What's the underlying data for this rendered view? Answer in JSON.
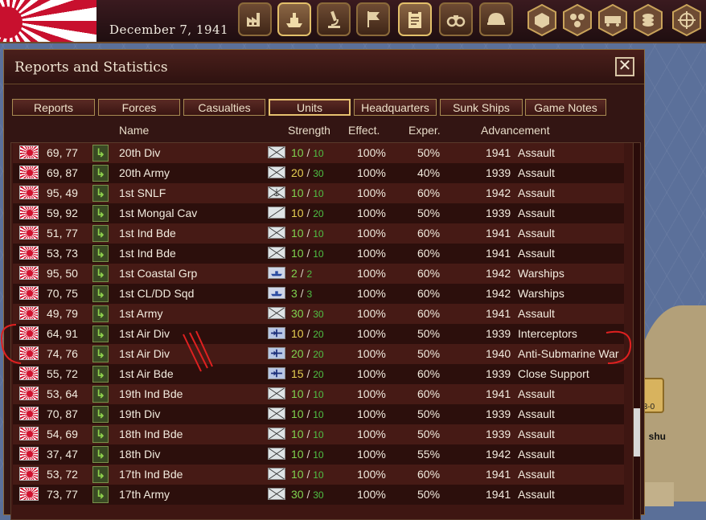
{
  "top_bar": {
    "date": "December 7, 1941",
    "buttons": [
      {
        "name": "production-button",
        "icon": "factory-icon"
      },
      {
        "name": "naval-button",
        "icon": "ship-icon"
      },
      {
        "name": "research-button",
        "icon": "microscope-icon"
      },
      {
        "name": "objectives-button",
        "icon": "flag-icon"
      },
      {
        "name": "reports-button",
        "icon": "clipboard-icon",
        "active": true
      },
      {
        "name": "intelligence-button",
        "icon": "binoculars-icon"
      },
      {
        "name": "army-button",
        "icon": "helmet-icon"
      }
    ],
    "hex_buttons": [
      "hex-tile-icon",
      "hex-grid-icon",
      "train-icon",
      "coins-icon",
      "crosshair-icon"
    ]
  },
  "window": {
    "title": "Reports and Statistics",
    "close_label": "✕",
    "tabs": [
      {
        "label": "Reports"
      },
      {
        "label": "Forces"
      },
      {
        "label": "Casualties"
      },
      {
        "label": "Units",
        "active": true
      },
      {
        "label": "Headquarters"
      },
      {
        "label": "Sunk Ships"
      },
      {
        "label": "Game Notes"
      }
    ],
    "columns": {
      "name": "Name",
      "strength": "Strength",
      "effect": "Effect.",
      "exper": "Exper.",
      "advancement": "Advancement"
    }
  },
  "units": [
    {
      "coords": "69, 77",
      "name": "20th Div",
      "type": "infantry",
      "cur": "10",
      "max": "10",
      "effect": "100%",
      "exper": "50%",
      "year": "1941",
      "adv": "Assault"
    },
    {
      "coords": "69, 87",
      "name": "20th Army",
      "type": "infantry",
      "cur": "20",
      "max": "30",
      "effect": "100%",
      "exper": "40%",
      "year": "1939",
      "adv": "Assault"
    },
    {
      "coords": "95, 49",
      "name": "1st SNLF",
      "type": "marine",
      "cur": "10",
      "max": "10",
      "effect": "100%",
      "exper": "60%",
      "year": "1942",
      "adv": "Assault"
    },
    {
      "coords": "59, 92",
      "name": "1st Mongal Cav",
      "type": "cavalry",
      "cur": "10",
      "max": "20",
      "effect": "100%",
      "exper": "50%",
      "year": "1939",
      "adv": "Assault"
    },
    {
      "coords": "51, 77",
      "name": "1st Ind Bde",
      "type": "infantry",
      "cur": "10",
      "max": "10",
      "effect": "100%",
      "exper": "60%",
      "year": "1941",
      "adv": "Assault"
    },
    {
      "coords": "53, 73",
      "name": "1st Ind Bde",
      "type": "infantry",
      "cur": "10",
      "max": "10",
      "effect": "100%",
      "exper": "60%",
      "year": "1941",
      "adv": "Assault"
    },
    {
      "coords": "95, 50",
      "name": "1st Coastal Grp",
      "type": "naval",
      "cur": "2",
      "max": "2",
      "effect": "100%",
      "exper": "60%",
      "year": "1942",
      "adv": "Warships"
    },
    {
      "coords": "70, 75",
      "name": "1st CL/DD Sqd",
      "type": "naval",
      "cur": "3",
      "max": "3",
      "effect": "100%",
      "exper": "60%",
      "year": "1942",
      "adv": "Warships"
    },
    {
      "coords": "49, 79",
      "name": "1st Army",
      "type": "infantry",
      "cur": "30",
      "max": "30",
      "effect": "100%",
      "exper": "60%",
      "year": "1941",
      "adv": "Assault"
    },
    {
      "coords": "64, 91",
      "name": "1st Air Div",
      "type": "air",
      "cur": "10",
      "max": "20",
      "effect": "100%",
      "exper": "50%",
      "year": "1939",
      "adv": "Interceptors"
    },
    {
      "coords": "74, 76",
      "name": "1st Air Div",
      "type": "air",
      "cur": "20",
      "max": "20",
      "effect": "100%",
      "exper": "50%",
      "year": "1940",
      "adv": "Anti-Submarine War"
    },
    {
      "coords": "55, 72",
      "name": "1st Air Bde",
      "type": "air",
      "cur": "15",
      "max": "20",
      "effect": "100%",
      "exper": "60%",
      "year": "1939",
      "adv": "Close Support"
    },
    {
      "coords": "53, 64",
      "name": "19th Ind Bde",
      "type": "infantry",
      "cur": "10",
      "max": "10",
      "effect": "100%",
      "exper": "60%",
      "year": "1941",
      "adv": "Assault"
    },
    {
      "coords": "70, 87",
      "name": "19th Div",
      "type": "infantry",
      "cur": "10",
      "max": "10",
      "effect": "100%",
      "exper": "50%",
      "year": "1939",
      "adv": "Assault"
    },
    {
      "coords": "54, 69",
      "name": "18th Ind Bde",
      "type": "infantry",
      "cur": "10",
      "max": "10",
      "effect": "100%",
      "exper": "50%",
      "year": "1939",
      "adv": "Assault"
    },
    {
      "coords": "37, 47",
      "name": "18th Div",
      "type": "infantry",
      "cur": "10",
      "max": "10",
      "effect": "100%",
      "exper": "55%",
      "year": "1942",
      "adv": "Assault"
    },
    {
      "coords": "53, 72",
      "name": "17th Ind Bde",
      "type": "infantry",
      "cur": "10",
      "max": "10",
      "effect": "100%",
      "exper": "60%",
      "year": "1941",
      "adv": "Assault"
    },
    {
      "coords": "73, 77",
      "name": "17th Army",
      "type": "infantry",
      "cur": "30",
      "max": "30",
      "effect": "100%",
      "exper": "50%",
      "year": "1941",
      "adv": "Assault"
    }
  ],
  "map": {
    "marker_label": "3-0",
    "place_label": "shu"
  },
  "colors": {
    "strength_full": "#7fd34f",
    "strength_partial": "#e6cf52",
    "annotation": "#e02020"
  }
}
